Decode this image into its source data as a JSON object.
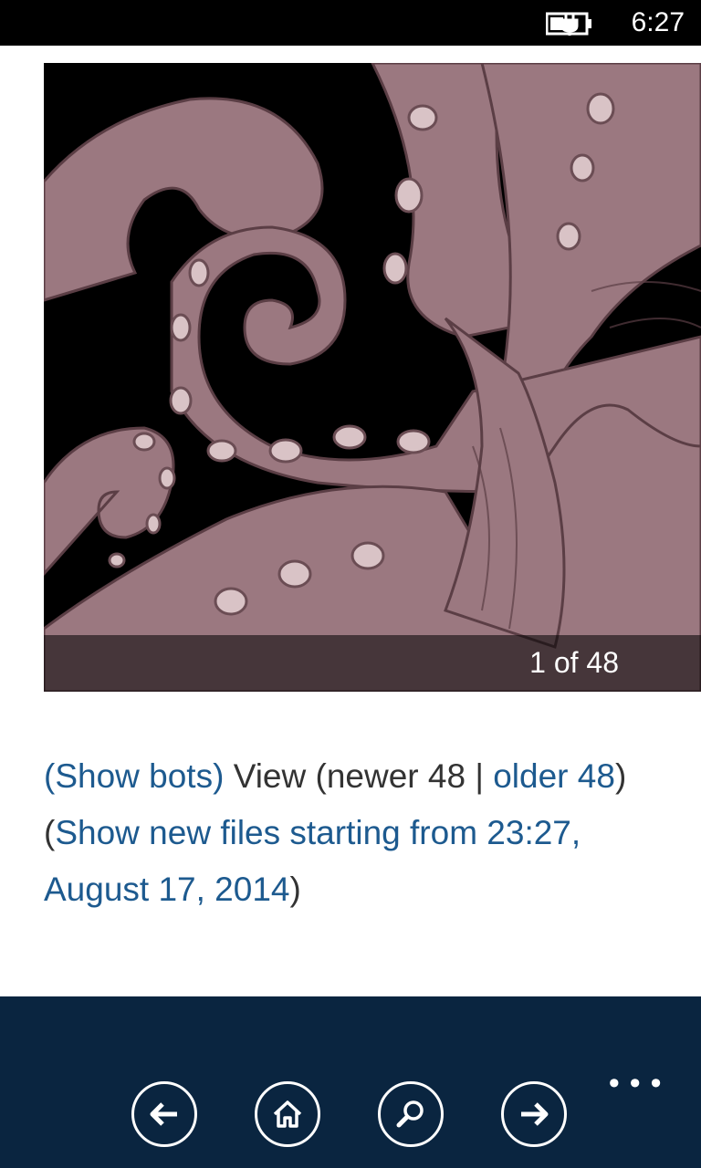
{
  "status_bar": {
    "time": "6:27",
    "battery_icon": "battery-charging-icon"
  },
  "gallery": {
    "counter": "1 of 48"
  },
  "nav_text": {
    "show_bots": "(Show bots)",
    "view_prefix": " View (newer 48 | ",
    "older_link": "older 48",
    "mid": ") (",
    "show_new_link": "Show new files starting from 23:27, August 17, 2014",
    "suffix": ")"
  },
  "app_bar": {
    "buttons": [
      {
        "icon": "back-arrow-icon"
      },
      {
        "icon": "home-icon"
      },
      {
        "icon": "search-icon"
      },
      {
        "icon": "forward-arrow-icon"
      }
    ],
    "more": "•••"
  },
  "colors": {
    "link": "#1d5a8f",
    "app_bar_bg": "#0a2540"
  }
}
